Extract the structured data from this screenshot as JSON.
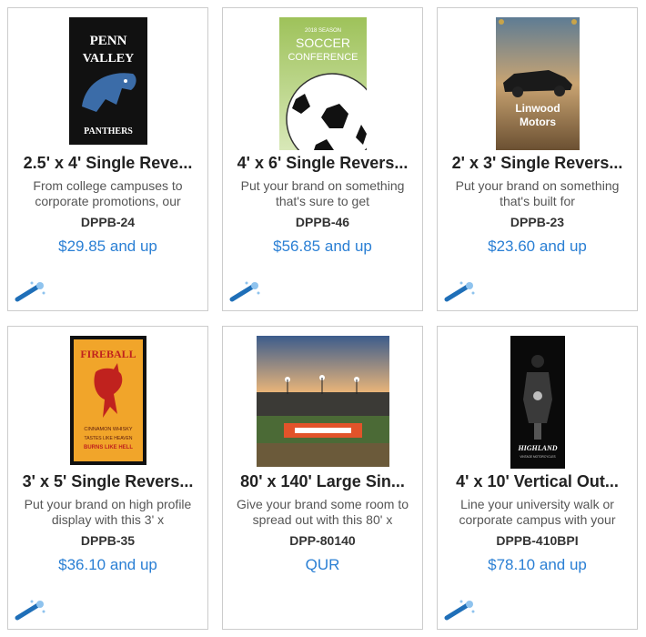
{
  "products": [
    {
      "title": "2.5' x 4' Single Reve...",
      "description": "From college campuses to corporate promotions, our",
      "sku": "DPPB-24",
      "price": "$29.85 and up",
      "image": {
        "lines": [
          "PENN",
          "VALLEY",
          "PANTHERS"
        ]
      }
    },
    {
      "title": "4' x 6' Single Revers...",
      "description": "Put your brand on something that's sure to get",
      "sku": "DPPB-46",
      "price": "$56.85 and up",
      "image": {
        "lines": [
          "2018 SEASON",
          "SOCCER",
          "CONFERENCE"
        ]
      }
    },
    {
      "title": "2' x 3' Single Revers...",
      "description": "Put your brand on something that's built for",
      "sku": "DPPB-23",
      "price": "$23.60 and up",
      "image": {
        "lines": [
          "Linwood",
          "Motors"
        ]
      }
    },
    {
      "title": "3' x 5' Single Revers...",
      "description": "Put your brand on high profile display with this 3' x",
      "sku": "DPPB-35",
      "price": "$36.10 and up",
      "image": {
        "lines": [
          "FIREBALL",
          "CINNAMON WHISKY",
          "TASTES LIKE HEAVEN",
          "BURNS LIKE HELL"
        ]
      }
    },
    {
      "title": "80' x 140' Large Sin...",
      "description": "Give your brand some room to spread out with this 80' x",
      "sku": "DPP-80140",
      "price": "QUR",
      "image": {
        "lines": []
      }
    },
    {
      "title": "4' x 10' Vertical Out...",
      "description": "Line your university walk or corporate campus with your",
      "sku": "DPPB-410BPI",
      "price": "$78.10 and up",
      "image": {
        "lines": [
          "HIGHLAND",
          "VINTAGE MOTORCYCLES"
        ]
      }
    }
  ],
  "colors": {
    "price": "#2a7fd4",
    "border": "#cccccc"
  },
  "icons": {
    "customize": "magic-wand-icon"
  }
}
